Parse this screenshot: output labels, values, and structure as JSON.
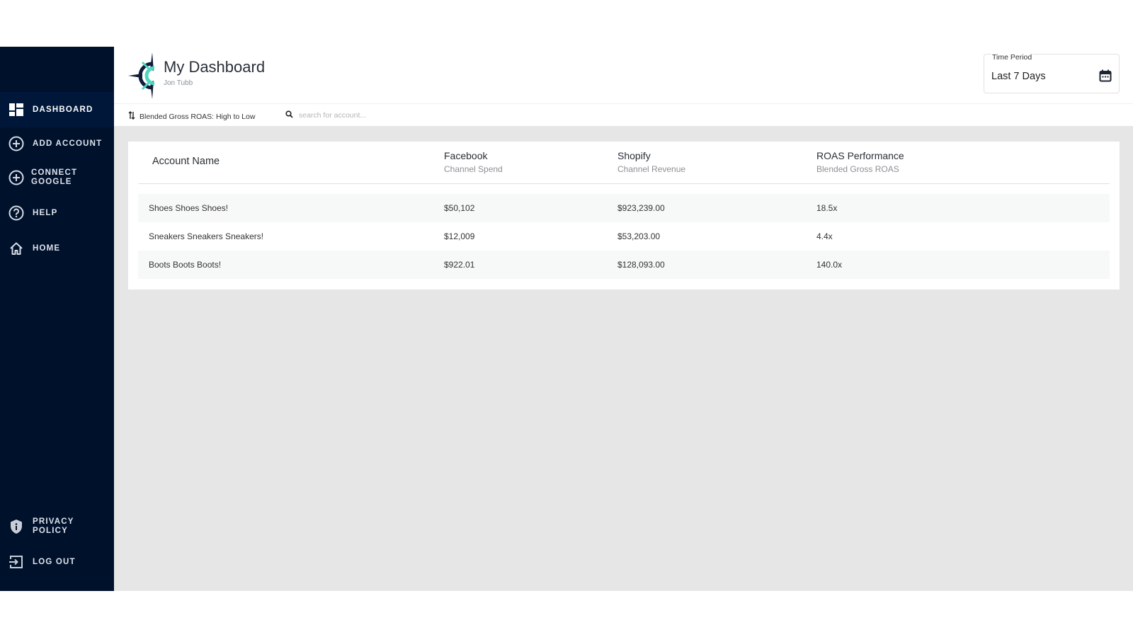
{
  "sidebar": {
    "items": [
      {
        "label": "Dashboard",
        "icon": "dashboard-icon",
        "active": true
      },
      {
        "label": "Add Account",
        "icon": "add-circle-icon"
      },
      {
        "label": "Connect Google",
        "icon": "add-circle-icon"
      },
      {
        "label": "Help",
        "icon": "help-circle-icon"
      },
      {
        "label": "Home",
        "icon": "home-icon"
      }
    ],
    "bottom_items": [
      {
        "label": "Privacy Policy",
        "icon": "shield-info-icon"
      },
      {
        "label": "Log Out",
        "icon": "logout-icon"
      }
    ]
  },
  "header": {
    "title": "My Dashboard",
    "user": "Jon Tubb",
    "time_period": {
      "label": "Time Period",
      "value": "Last 7 Days",
      "icon": "calendar-icon"
    }
  },
  "toolbar": {
    "sort_label": "Blended Gross ROAS: High to Low",
    "sort_icon": "sort-icon",
    "search_placeholder": "search for account...",
    "search_value": "",
    "search_icon": "search-icon"
  },
  "table": {
    "columns": [
      {
        "title": "Account Name",
        "subtitle": ""
      },
      {
        "title": "Facebook",
        "subtitle": "Channel Spend"
      },
      {
        "title": "Shopify",
        "subtitle": "Channel Revenue"
      },
      {
        "title": "ROAS Performance",
        "subtitle": "Blended Gross ROAS"
      }
    ],
    "rows": [
      {
        "account": "Shoes Shoes Shoes!",
        "spend": "$50,102",
        "revenue": "$923,239.00",
        "roas": "18.5x"
      },
      {
        "account": "Sneakers Sneakers Sneakers!",
        "spend": "$12,009",
        "revenue": "$53,203.00",
        "roas": "4.4x"
      },
      {
        "account": "Boots Boots Boots!",
        "spend": "$922.01",
        "revenue": "$128,093.00",
        "roas": "140.0x"
      }
    ]
  },
  "colors": {
    "sidebar_bg": "#00112b",
    "sidebar_active_bg": "#01173a",
    "accent_teal": "#4fd6c0",
    "main_bg": "#e6e6e6"
  }
}
